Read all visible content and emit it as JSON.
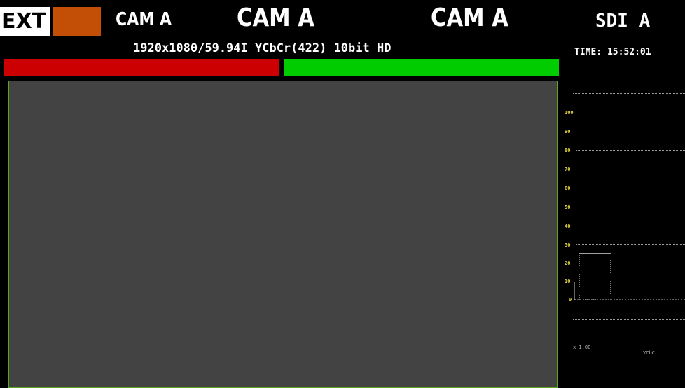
{
  "header": {
    "ext_label": "EXT",
    "cam_small": "CAM A",
    "cam_center": "CAM A",
    "cam_right": "CAM A",
    "sdi_label": "SDI A",
    "format": "1920x1080/59.94I YCbCr(422) 10bit HD",
    "time": "TIME: 15:52:01",
    "colors": {
      "ext_swatch": "#c24f05",
      "status_left": "#cc0000",
      "status_right": "#00cc00",
      "picture_bg": "#434343",
      "picture_border": "#5aa822",
      "scale_text": "#e0d040"
    }
  },
  "histogram": {
    "scale_labels": [
      "100",
      "90",
      "80",
      "70",
      "60",
      "50",
      "40",
      "30",
      "20",
      "10",
      "0"
    ],
    "zoom": "x 1.00",
    "mode": "YCbCr"
  }
}
